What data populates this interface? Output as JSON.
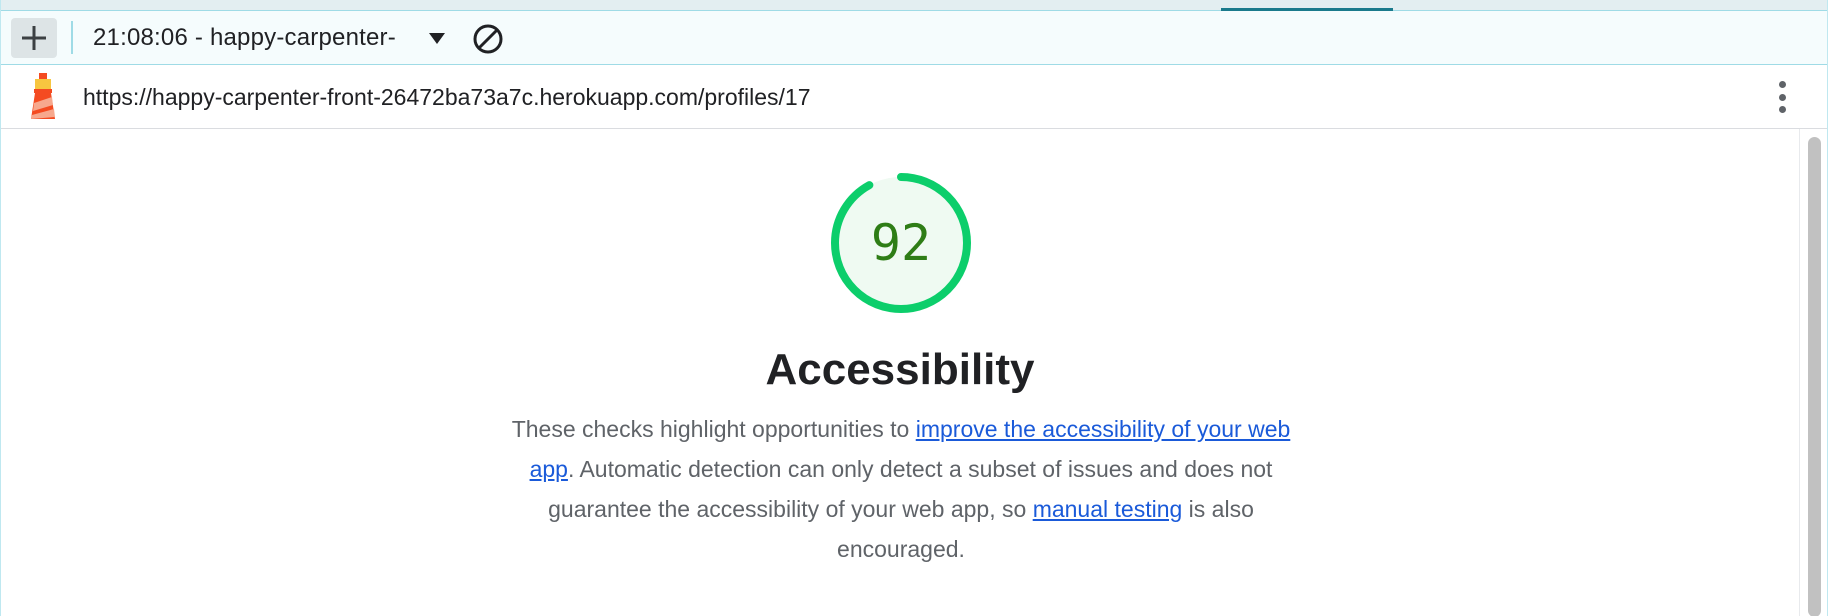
{
  "toolbar": {
    "add_report_icon": "plus-icon",
    "report_select_label": "21:08:06 - happy-carpenter-",
    "report_select_caret_icon": "caret-down-icon",
    "clear_icon": "clear-circle-slash-icon"
  },
  "urlbar": {
    "logo_icon": "lighthouse-logo-icon",
    "url": "https://happy-carpenter-front-26472ba73a7c.herokuapp.com/profiles/17",
    "menu_icon": "kebab-menu-icon"
  },
  "category": {
    "score": "92",
    "score_fraction": 0.92,
    "score_color": "#0cce6b",
    "title": "Accessibility",
    "description": {
      "part1": "These checks highlight opportunities to ",
      "link1": "improve the accessibility of your web app",
      "part2": ". Automatic detection can only detect a subset of issues and does not guarantee the accessibility of your web app, so ",
      "link2": "manual testing",
      "part3": " is also encouraged."
    }
  },
  "colors": {
    "link": "#1a5ad9",
    "score_text": "#2e7d16",
    "score_arc": "#0cce6b",
    "score_fill": "#effaf2"
  }
}
